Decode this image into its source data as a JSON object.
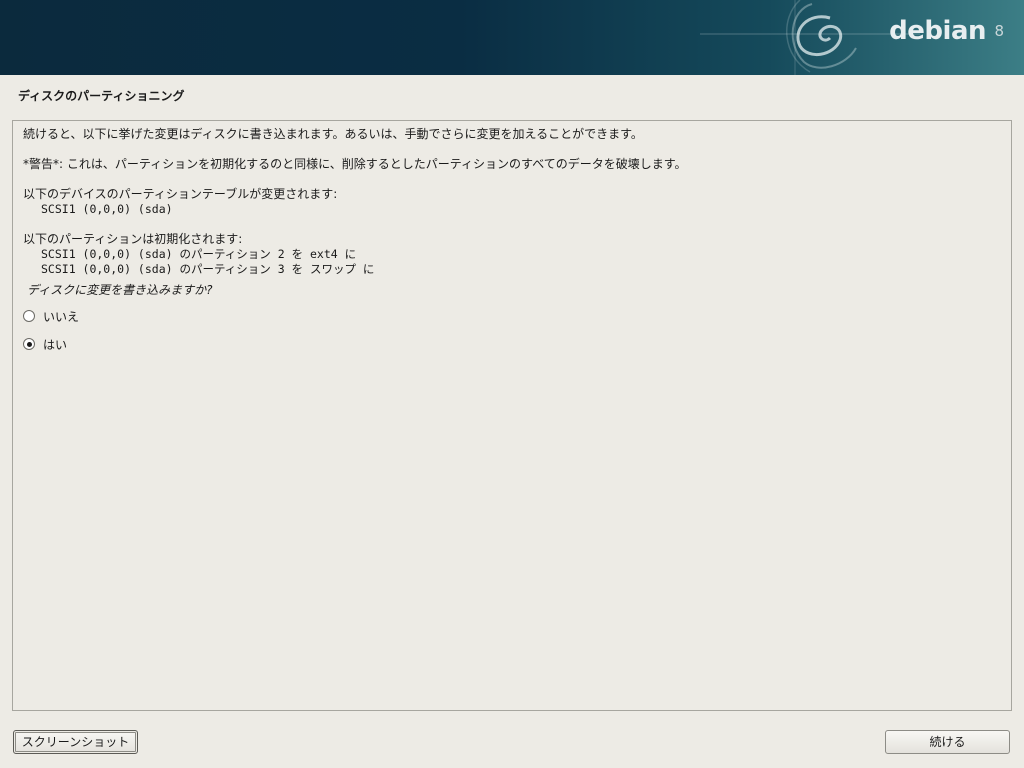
{
  "header": {
    "logo_text": "debian",
    "logo_version": "8"
  },
  "page_title": "ディスクのパーティショニング",
  "body": {
    "intro": "続けると、以下に挙げた変更はディスクに書き込まれます。あるいは、手動でさらに変更を加えることができます。",
    "warning": "*警告*: これは、パーティションを初期化するのと同様に、削除するとしたパーティションのすべてのデータを破壊します。",
    "table_change_heading": "以下のデバイスのパーティションテーブルが変更されます:",
    "table_change_items": [
      "SCSI1 (0,0,0) (sda)"
    ],
    "format_heading": "以下のパーティションは初期化されます:",
    "format_items": [
      "SCSI1 (0,0,0) (sda) のパーティション 2 を ext4 に",
      "SCSI1 (0,0,0) (sda) のパーティション 3 を スワップ に"
    ],
    "question": "ディスクに変更を書き込みますか?"
  },
  "options": [
    {
      "label": "いいえ",
      "selected": false
    },
    {
      "label": "はい",
      "selected": true
    }
  ],
  "buttons": {
    "screenshot": "スクリーンショット",
    "continue": "続ける"
  }
}
